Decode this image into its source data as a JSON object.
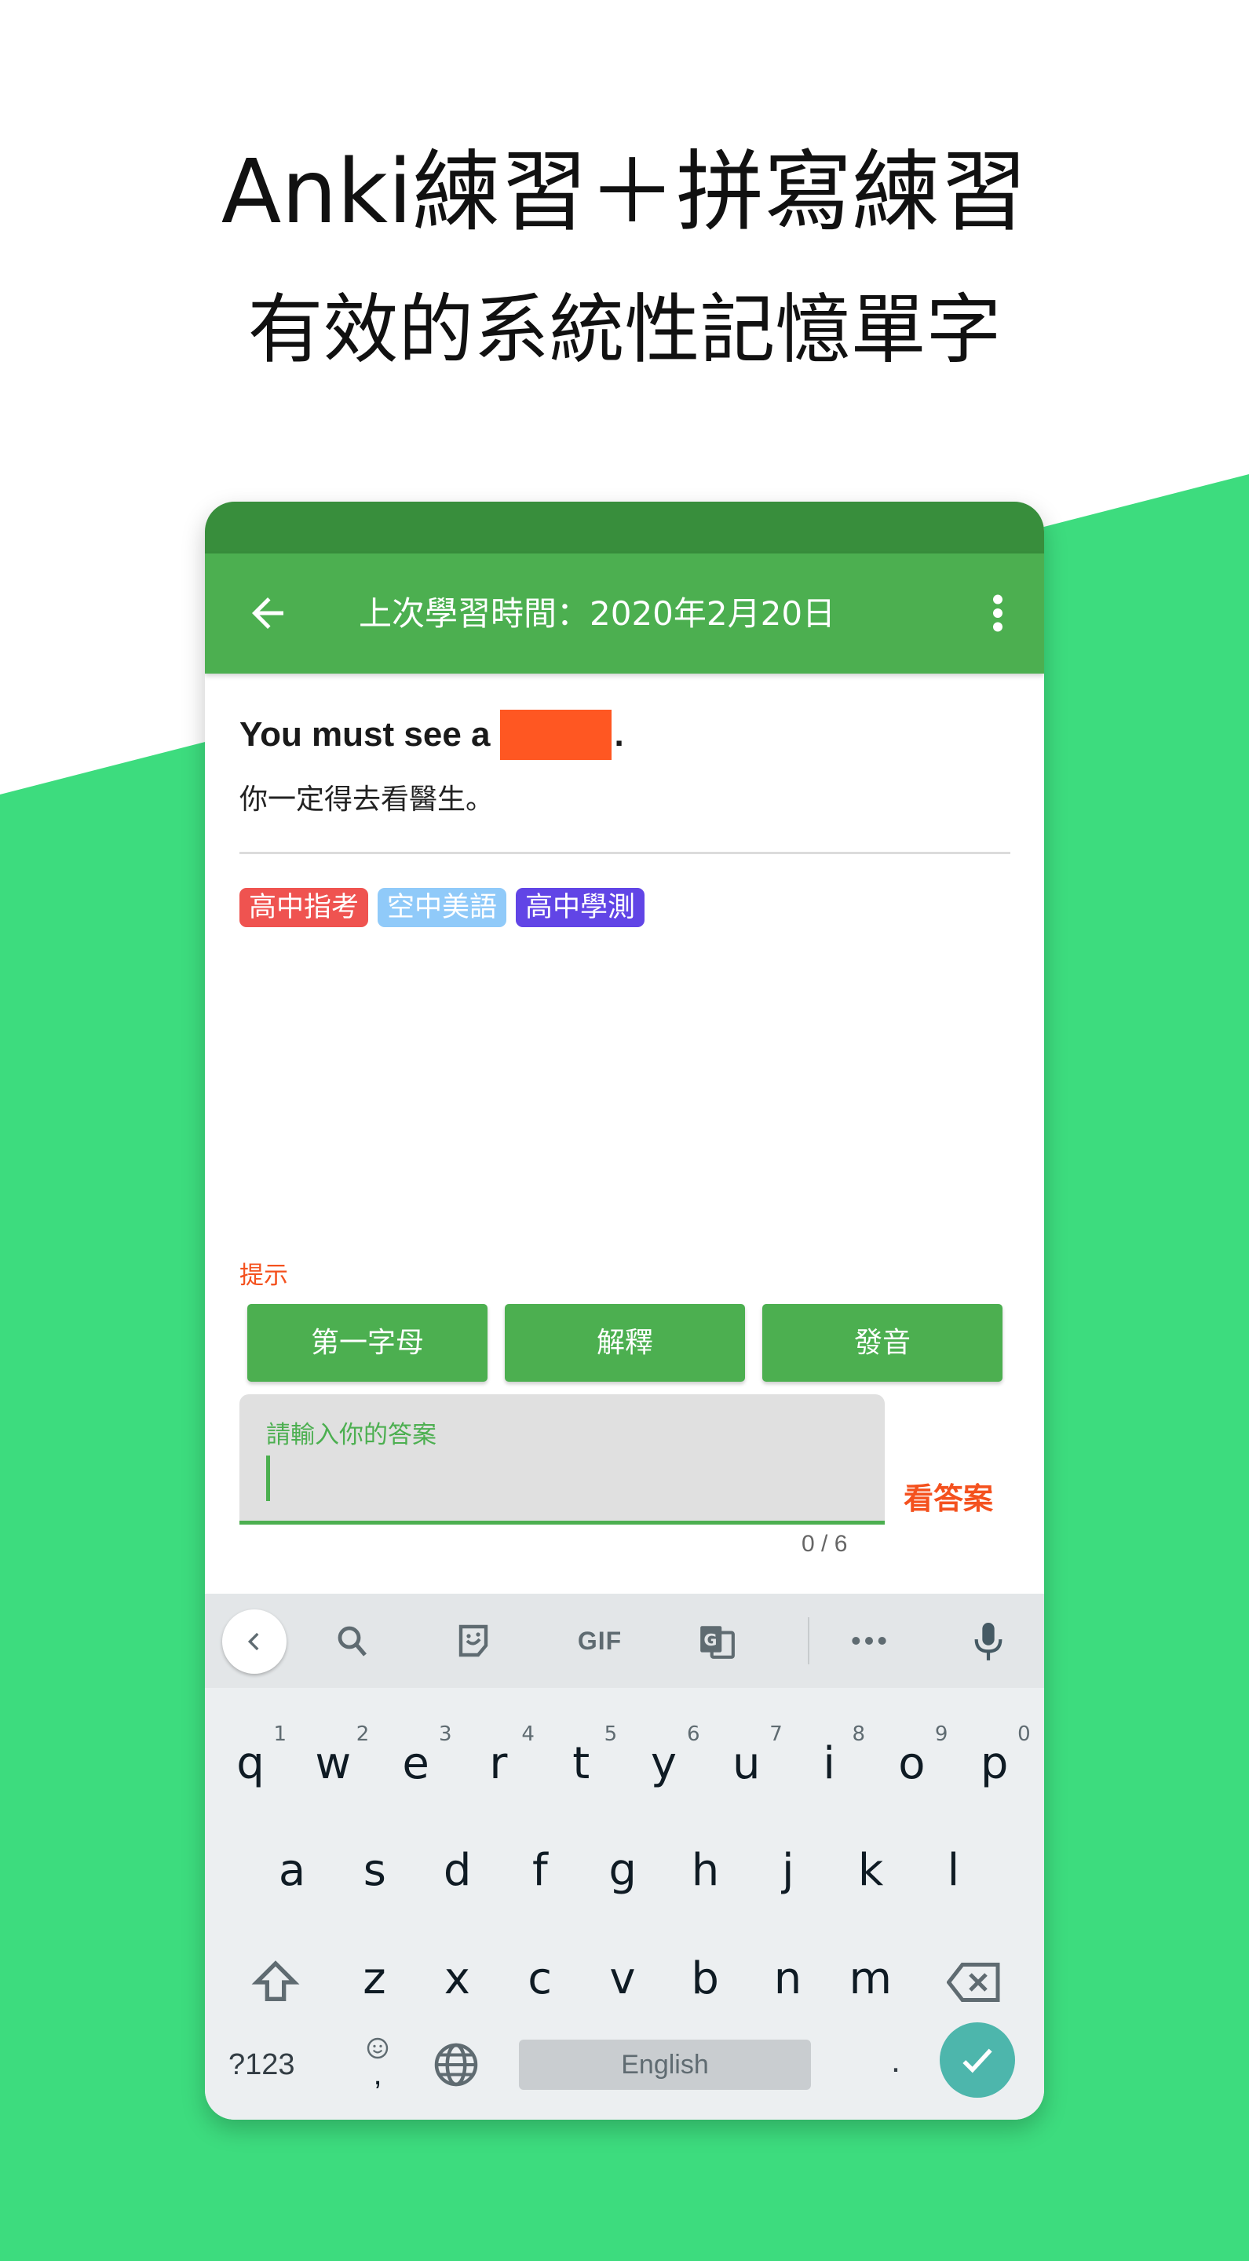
{
  "promo": {
    "headline_line1": "Anki練習＋拼寫練習",
    "headline_line2": "有效的系統性記憶單字",
    "colors": {
      "background_green": "#3ddc7e",
      "background_white": "#ffffff"
    }
  },
  "app": {
    "appbar": {
      "title": "上次學習時間：2020年2月20日",
      "back_icon": "arrow-left-icon",
      "menu_icon": "more-vert-icon",
      "color": "#4caf50",
      "status_bar_color": "#388e3c"
    },
    "card": {
      "sentence_before_blank": "You must see a",
      "sentence_after_blank": ".",
      "blank_color": "#ff5722",
      "translation": "你一定得去看醫生。",
      "tags": [
        {
          "label": "高中指考",
          "color": "#ef5350"
        },
        {
          "label": "空中美語",
          "color": "#90caf9"
        },
        {
          "label": "高中學測",
          "color": "#6145e6"
        }
      ]
    },
    "hints": {
      "label": "提示",
      "buttons": [
        "第一字母",
        "解釋",
        "發音"
      ]
    },
    "answer": {
      "placeholder": "請輸入你的答案",
      "value": "",
      "counter": "0 / 6",
      "show_answer_label": "看答案"
    }
  },
  "keyboard": {
    "toolbar": [
      "collapse-icon",
      "search-icon",
      "sticker-icon",
      "gif-icon",
      "translate-icon",
      "more-horiz-icon",
      "microphone-icon"
    ],
    "gif_label": "GIF",
    "row1": [
      {
        "key": "q",
        "hint": "1"
      },
      {
        "key": "w",
        "hint": "2"
      },
      {
        "key": "e",
        "hint": "3"
      },
      {
        "key": "r",
        "hint": "4"
      },
      {
        "key": "t",
        "hint": "5"
      },
      {
        "key": "y",
        "hint": "6"
      },
      {
        "key": "u",
        "hint": "7"
      },
      {
        "key": "i",
        "hint": "8"
      },
      {
        "key": "o",
        "hint": "9"
      },
      {
        "key": "p",
        "hint": "0"
      }
    ],
    "row2": [
      "a",
      "s",
      "d",
      "f",
      "g",
      "h",
      "j",
      "k",
      "l"
    ],
    "row3": [
      "z",
      "x",
      "c",
      "v",
      "b",
      "n",
      "m"
    ],
    "symbols_label": "?123",
    "comma_label": ",",
    "space_label": "English",
    "period_label": ".",
    "enter_icon": "check-icon"
  }
}
